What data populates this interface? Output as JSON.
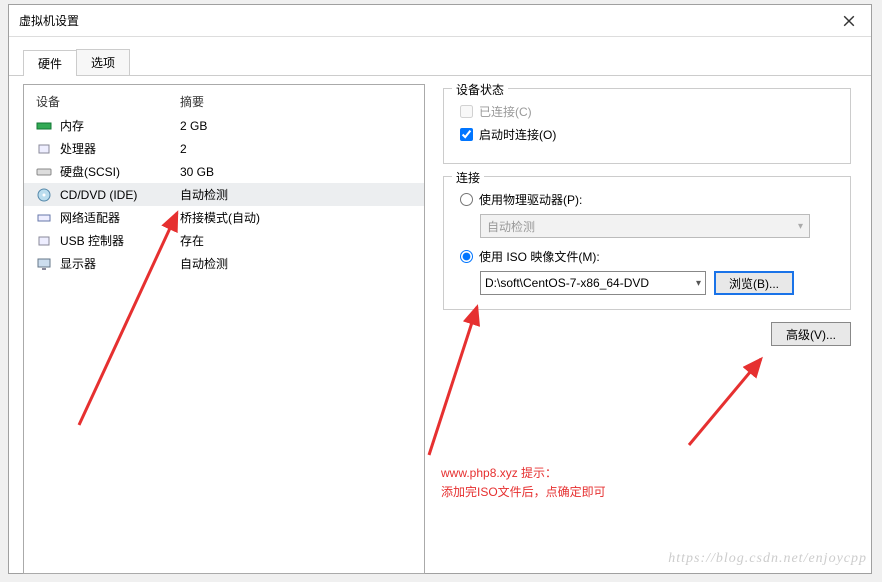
{
  "window": {
    "title": "虚拟机设置"
  },
  "tabs": {
    "hardware": "硬件",
    "options": "选项"
  },
  "devlist": {
    "header_device": "设备",
    "header_summary": "摘要",
    "rows": [
      {
        "name": "内存",
        "summary": "2 GB"
      },
      {
        "name": "处理器",
        "summary": "2"
      },
      {
        "name": "硬盘(SCSI)",
        "summary": "30 GB"
      },
      {
        "name": "CD/DVD (IDE)",
        "summary": "自动检测"
      },
      {
        "name": "网络适配器",
        "summary": "桥接模式(自动)"
      },
      {
        "name": "USB 控制器",
        "summary": "存在"
      },
      {
        "name": "显示器",
        "summary": "自动检测"
      }
    ]
  },
  "status": {
    "group": "设备状态",
    "connected": "已连接(C)",
    "connect_at_poweron": "启动时连接(O)"
  },
  "connection": {
    "group": "连接",
    "use_physical": "使用物理驱动器(P):",
    "physical_value": "自动检测",
    "use_iso": "使用 ISO 映像文件(M):",
    "iso_path": "D:\\soft\\CentOS-7-x86_64-DVD",
    "browse": "浏览(B)..."
  },
  "advanced": {
    "label": "高级(V)..."
  },
  "hint": {
    "line1": "www.php8.xyz 提示：",
    "line2": "添加完ISO文件后，点确定即可"
  },
  "watermark": "https://blog.csdn.net/enjoycpp"
}
